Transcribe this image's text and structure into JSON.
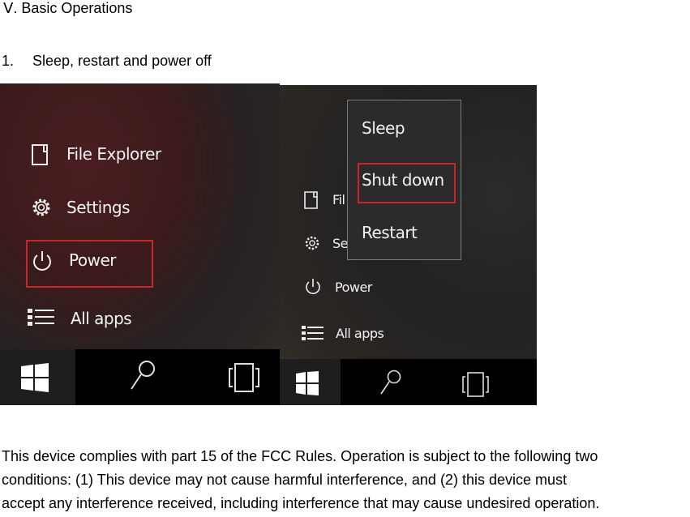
{
  "heading": "Ⅴ. Basic Operations",
  "section": {
    "number": "1.",
    "title": "Sleep, restart and power off"
  },
  "screenshot_left": {
    "menu_items": [
      "File Explorer",
      "Settings",
      "Power",
      "All apps"
    ],
    "highlighted": "Power",
    "taskbar": [
      "windows-start-icon",
      "search-icon",
      "task-view-icon"
    ]
  },
  "screenshot_right": {
    "menu_items_partial": [
      "Fil",
      "Se",
      "Power",
      "All apps"
    ],
    "power_menu": [
      "Sleep",
      "Shut down",
      "Restart"
    ],
    "highlighted": "Shut down",
    "taskbar": [
      "windows-start-icon",
      "search-icon",
      "task-view-icon"
    ]
  },
  "fcc_lines": [
    "This device complies with part 15 of the FCC Rules. Operation is subject to the following two",
    "conditions: (1) This device may not cause harmful interference, and (2) this device must",
    "accept any interference received, including interference that may cause undesired operation."
  ],
  "colors": {
    "highlight": "#c8262b"
  }
}
